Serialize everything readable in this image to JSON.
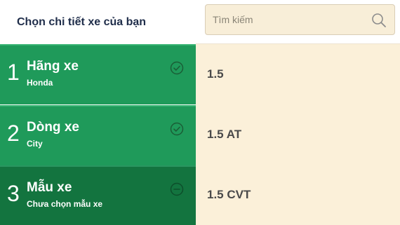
{
  "header": {
    "title": "Chọn chi tiết xe của bạn"
  },
  "search": {
    "placeholder": "Tìm kiếm",
    "value": ""
  },
  "steps": [
    {
      "number": "1",
      "title": "Hãng xe",
      "value": "Honda",
      "status": "done"
    },
    {
      "number": "2",
      "title": "Dòng xe",
      "value": "City",
      "status": "done"
    },
    {
      "number": "3",
      "title": "Mẫu xe",
      "value": "Chưa chọn mẫu xe",
      "status": "pending"
    }
  ],
  "options": [
    {
      "label": "1.5"
    },
    {
      "label": "1.5 AT"
    },
    {
      "label": "1.5 CVT"
    }
  ],
  "colors": {
    "step_active": "#1f9a5a",
    "step_current": "#13743f",
    "options_bg": "#fbf0d9",
    "title_text": "#1f2d4a"
  },
  "icons": {
    "done": "check-circle-icon",
    "pending": "minus-circle-icon",
    "search": "search-icon"
  }
}
